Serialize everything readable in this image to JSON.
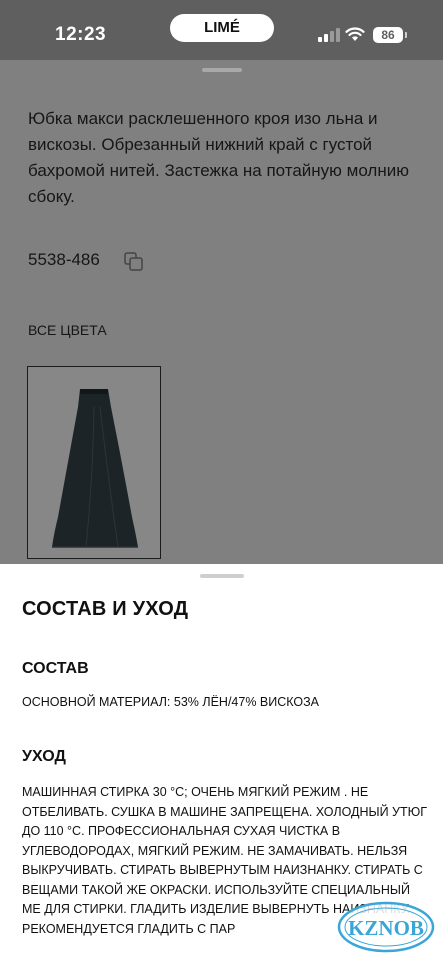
{
  "status_bar": {
    "time": "12:23",
    "site": "LIMÉ",
    "battery": "86",
    "icons": [
      "signal-icon",
      "wifi-icon",
      "battery-icon"
    ]
  },
  "product": {
    "description": "Юбка макси расклешенного кроя изо льна и вискозы. Обрезанный нижний край с густой бахромой нитей. Застежка на потайную молнию сбоку.",
    "article": "5538-486",
    "all_colors_label": "ВСЕ ЦВЕТА"
  },
  "sheet": {
    "title": "СОСТАВ И УХОД",
    "composition": {
      "heading": "СОСТАВ",
      "text": "ОСНОВНОЙ МАТЕРИАЛ: 53% ЛЁН/47% ВИСКОЗА"
    },
    "care": {
      "heading": "УХОД",
      "text": "МАШИННАЯ СТИРКА 30 °C; ОЧЕНЬ МЯГКИЙ РЕЖИМ . НЕ ОТБЕЛИВАТЬ. СУШКА В МАШИНЕ ЗАПРЕЩЕНА. ХОЛОДНЫЙ УТЮГ ДО 110 °C. ПРОФЕССИОНАЛЬНАЯ СУХАЯ ЧИСТКА В УГЛЕВОДОРОДАХ, МЯГКИЙ РЕЖИМ. НЕ ЗАМАЧИВАТЬ. НЕЛЬЗЯ ВЫКРУЧИВАТЬ. СТИРАТЬ ВЫВЕРНУТЫМ НАИЗНАНКУ. СТИРАТЬ С ВЕЩАМИ ТАКОЙ ЖЕ ОКРАСКИ. ИСПОЛЬЗУЙТЕ СПЕЦИАЛЬНЫЙ МЕ ДЛЯ СТИРКИ. ГЛАДИТЬ ИЗДЕЛИЕ ВЫВЕРНУТЬ НАИЗНАНКУ. РЕКОМЕНДУЕТСЯ ГЛАДИТЬ С ПАР"
    }
  },
  "watermark": "KZNOB",
  "colors": {
    "status_bg": "#5f5f5f",
    "overlay_bg": "#808080",
    "sheet_bg": "#ffffff",
    "skirt": "#1d2427",
    "watermark": "#3aa6d8"
  }
}
